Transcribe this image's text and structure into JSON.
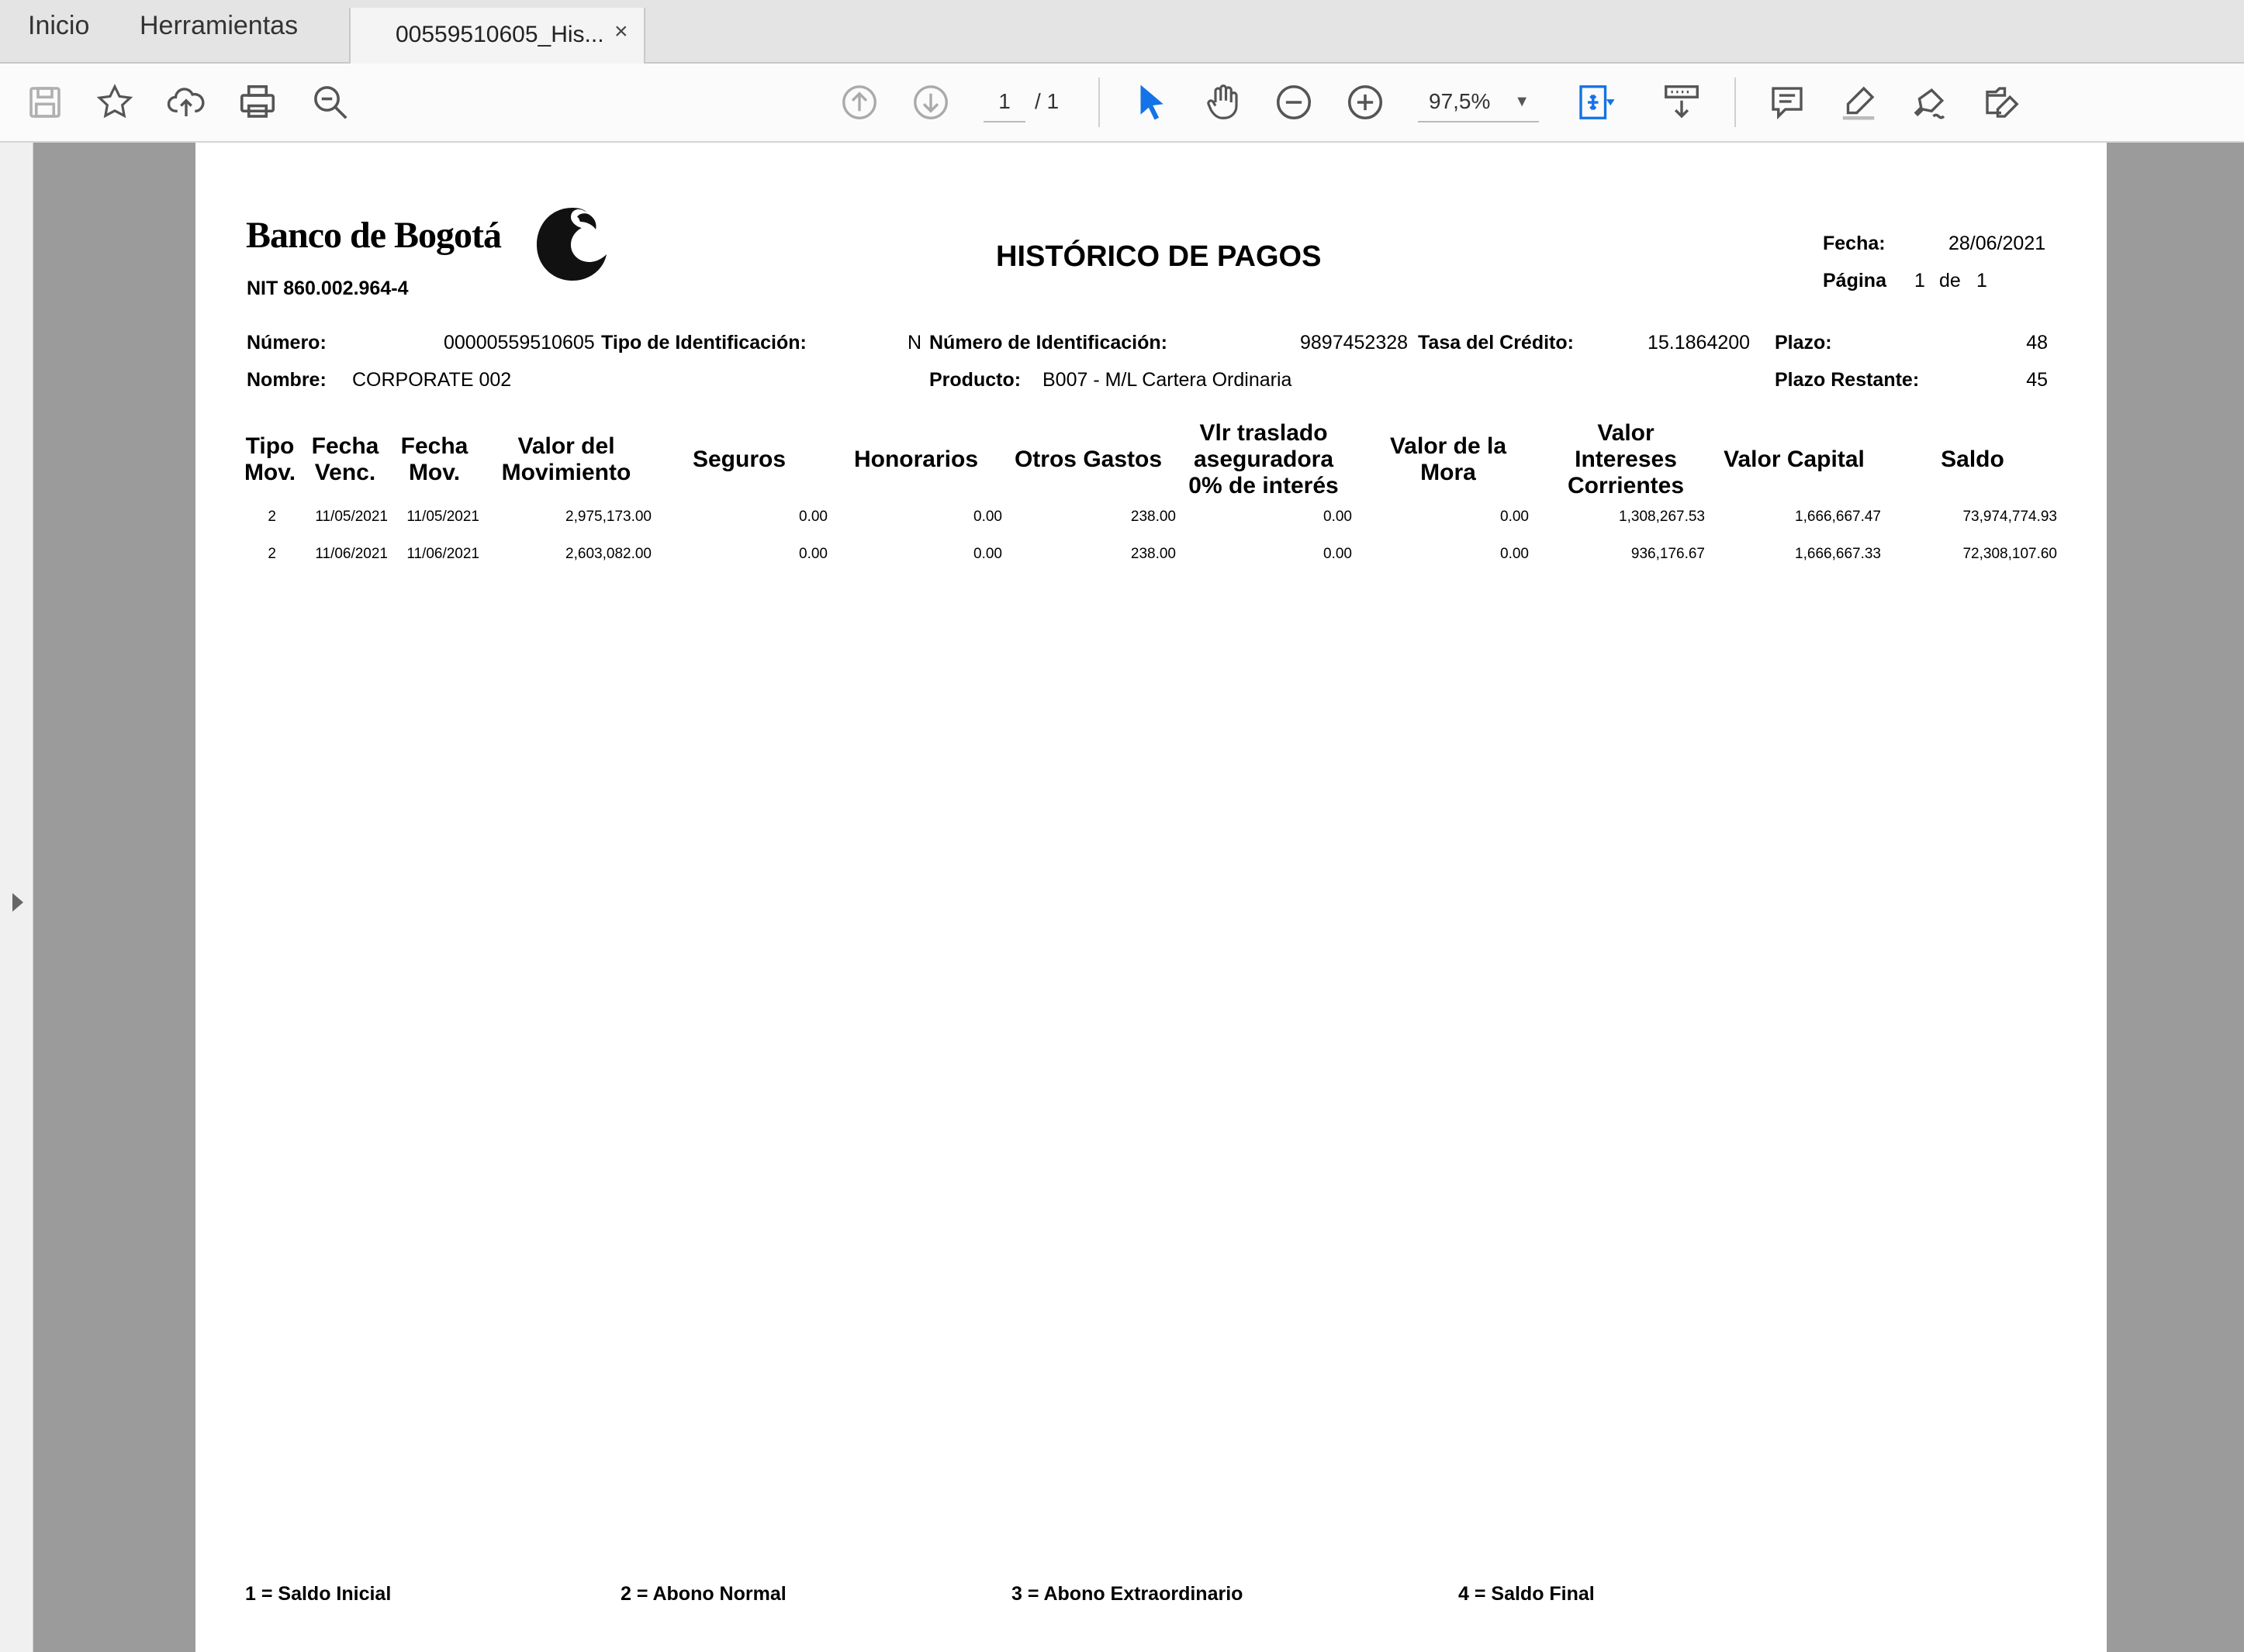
{
  "tabs": {
    "home": "Inicio",
    "tools": "Herramientas",
    "document": "00559510605_His...",
    "close": "×"
  },
  "toolbar": {
    "page_current": "1",
    "page_total": "/ 1",
    "zoom": "97,5%",
    "icons": [
      "save-icon",
      "bookmark-star-icon",
      "upload-cloud-icon",
      "print-icon",
      "find-zoom-icon",
      "page-up-icon",
      "page-down-icon",
      "select-cursor-icon",
      "hand-pan-icon",
      "zoom-out-icon",
      "zoom-in-icon",
      "fit-page-icon",
      "scroll-mode-icon",
      "comment-icon",
      "highlight-icon",
      "sign-icon",
      "edit-icon"
    ]
  },
  "colors": {
    "accent_blue": "#1473e6",
    "viewer_gray": "#9b9b9b"
  },
  "document": {
    "bank_name": "Banco de Bogotá",
    "nit": "NIT 860.002.964-4",
    "title": "HISTÓRICO DE PAGOS",
    "fecha_label": "Fecha:",
    "fecha_value": "28/06/2021",
    "pagina_label": "Página",
    "pagina_num": "1",
    "pagina_de": "de",
    "pagina_total": "1",
    "numero_label": "Número:",
    "numero_value": "00000559510605",
    "tipo_id_label": "Tipo de Identificación:",
    "tipo_id_value": "N",
    "num_id_label": "Número de Identificación:",
    "num_id_value": "9897452328",
    "tasa_label": "Tasa del Crédito:",
    "tasa_value": "15.1864200",
    "plazo_label": "Plazo:",
    "plazo_value": "48",
    "nombre_label": "Nombre:",
    "nombre_value": "CORPORATE 002",
    "producto_label": "Producto:",
    "producto_value": "B007 - M/L Cartera Ordinaria",
    "plazo_restante_label": "Plazo Restante:",
    "plazo_restante_value": "45",
    "columns": [
      "Tipo\nMov.",
      "Fecha\nVenc.",
      "Fecha\nMov.",
      "Valor del\nMovimiento",
      "Seguros",
      "Honorarios",
      "Otros Gastos",
      "Vlr traslado\naseguradora\n0% de interés",
      "Valor de la\nMora",
      "Valor\nIntereses\nCorrientes",
      "Valor Capital",
      "Saldo"
    ],
    "rows": [
      [
        "2",
        "11/05/2021",
        "11/05/2021",
        "2,975,173.00",
        "0.00",
        "0.00",
        "238.00",
        "0.00",
        "0.00",
        "1,308,267.53",
        "1,666,667.47",
        "73,974,774.93"
      ],
      [
        "2",
        "11/06/2021",
        "11/06/2021",
        "2,603,082.00",
        "0.00",
        "0.00",
        "238.00",
        "0.00",
        "0.00",
        "936,176.67",
        "1,666,667.33",
        "72,308,107.60"
      ]
    ],
    "legend": [
      "1 = Saldo Inicial",
      "2 = Abono Normal",
      "3 = Abono Extraordinario",
      "4 = Saldo Final"
    ]
  }
}
